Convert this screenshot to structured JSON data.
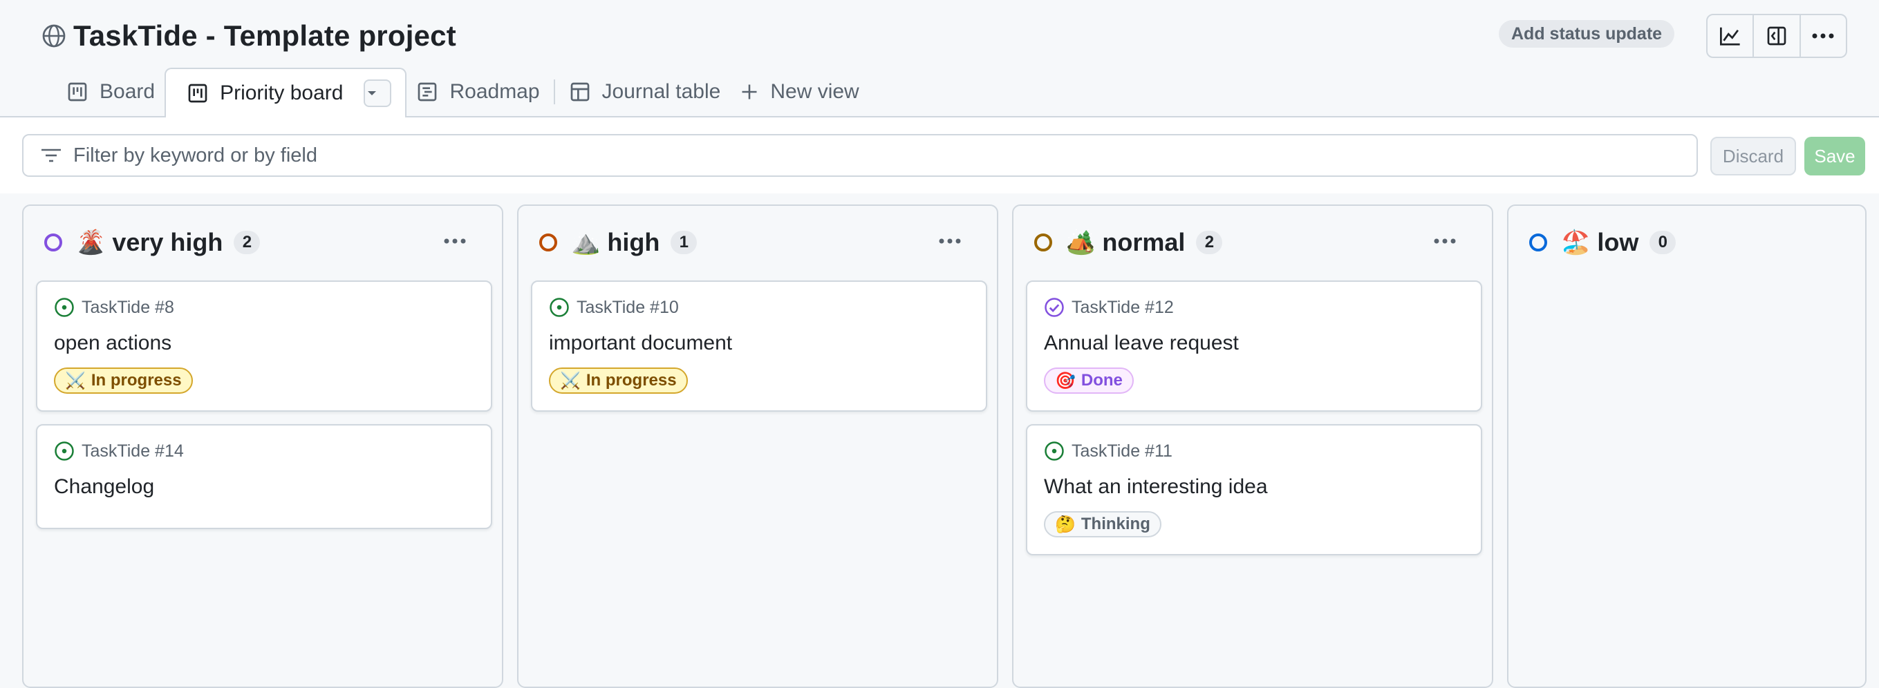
{
  "project": {
    "title": "TaskTide - Template project",
    "status_update": "Add status update"
  },
  "toolbar_icons": [
    "chart-icon",
    "sidebar-panel-icon",
    "more-options-icon"
  ],
  "tabs": [
    {
      "label": "Board",
      "icon": "board-icon"
    },
    {
      "label": "Priority board",
      "icon": "board-icon",
      "active": true
    },
    {
      "label": "Roadmap",
      "icon": "roadmap-icon"
    },
    {
      "label": "Journal table",
      "icon": "table-icon"
    },
    {
      "label": "New view",
      "icon": "plus-icon"
    }
  ],
  "filter": {
    "placeholder": "Filter by keyword or by field",
    "discard": "Discard",
    "save": "Save"
  },
  "colors": {
    "accent_green": "#1a7f37",
    "purple": "#8250df",
    "orange": "#bc4c00",
    "yellow": "#9a6700",
    "blue": "#0969da"
  },
  "columns": [
    {
      "emoji": "🌋",
      "name": "very high",
      "count": "2",
      "color": "#8250df",
      "cards": [
        {
          "ref": "TaskTide #8",
          "title": "open actions",
          "status": "open",
          "badge": {
            "emoji": "⚔️",
            "label": "In progress",
            "kind": "progress"
          }
        },
        {
          "ref": "TaskTide #14",
          "title": "Changelog",
          "status": "open"
        }
      ]
    },
    {
      "emoji": "⛰️",
      "name": "high",
      "count": "1",
      "color": "#bc4c00",
      "cards": [
        {
          "ref": "TaskTide #10",
          "title": "important document",
          "status": "open",
          "badge": {
            "emoji": "⚔️",
            "label": "In progress",
            "kind": "progress"
          }
        }
      ]
    },
    {
      "emoji": "🏕️",
      "name": "normal",
      "count": "2",
      "color": "#9a6700",
      "cards": [
        {
          "ref": "TaskTide #12",
          "title": "Annual leave request",
          "status": "done",
          "badge": {
            "emoji": "🎯",
            "label": "Done",
            "kind": "done"
          }
        },
        {
          "ref": "TaskTide #11",
          "title": "What an interesting idea",
          "status": "open",
          "badge": {
            "emoji": "🤔",
            "label": "Thinking",
            "kind": "thinking"
          }
        }
      ]
    },
    {
      "emoji": "🏖️",
      "name": "low",
      "count": "0",
      "color": "#0969da",
      "cards": []
    }
  ]
}
